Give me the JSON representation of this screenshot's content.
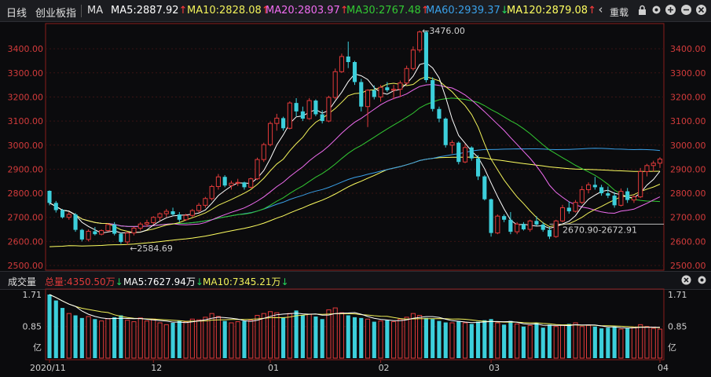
{
  "header": {
    "tab_day": "日线",
    "index_name": "创业板指",
    "indicator": "MA",
    "back_icon": "‹",
    "reset_label": "重载",
    "ma": [
      {
        "label": "MA5:2887.92",
        "arrow": "↑",
        "color": "#ffffff",
        "arrow_color": "#ff3b3b"
      },
      {
        "label": "MA10:2828.08",
        "arrow": "↑",
        "color": "#f2f25a",
        "arrow_color": "#ff3b3b"
      },
      {
        "label": "MA20:2803.97",
        "arrow": "↑",
        "color": "#f06cf0",
        "arrow_color": "#ff3b3b"
      },
      {
        "label": "MA30:2767.48",
        "arrow": "↑",
        "color": "#32c832",
        "arrow_color": "#ff3b3b"
      },
      {
        "label": "MA60:2939.37",
        "arrow": "↓",
        "color": "#3aa0e8",
        "arrow_color": "#22d45a"
      },
      {
        "label": "MA120:2879.08",
        "arrow": "↑",
        "color": "#ffff60",
        "arrow_color": "#ff3b3b"
      }
    ]
  },
  "volume_header": {
    "title": "成交量",
    "total": "总量:4350.50万",
    "total_arrow": "↓",
    "ma5": "MA5:7627.94万",
    "ma5_arrow": "↓",
    "ma10": "MA10:7345.21万",
    "ma10_arrow": "↓"
  },
  "colors": {
    "up": "#e23a3a",
    "down": "#3ccfdb",
    "ma5": "#ffffff",
    "ma10": "#f2f25a",
    "ma20": "#f06cf0",
    "ma30": "#32c832",
    "ma60": "#3aa0e8",
    "ma120": "#ffff60"
  },
  "chart_data": {
    "type": "candlestick",
    "price_axis": {
      "ylim": [
        2500,
        3500
      ],
      "ticks": [
        "3400.00",
        "3300.00",
        "3200.00",
        "3100.00",
        "3000.00",
        "2900.00",
        "2800.00",
        "2700.00",
        "2600.00",
        "2500.00"
      ]
    },
    "volume_axis": {
      "ticks": [
        "1.71",
        "0.85",
        "亿"
      ]
    },
    "x_labels": [
      "2020/11",
      "12",
      "01",
      "02",
      "03",
      "04"
    ],
    "annotations": {
      "high": "3476.00",
      "low": "2584.69",
      "support": "2670.90-2672.91",
      "high_value": 3476.0,
      "low_value": 2584.69,
      "support_value": 2671.9
    },
    "ohlc": [
      [
        2810,
        2812,
        2750,
        2760
      ],
      [
        2760,
        2768,
        2720,
        2730
      ],
      [
        2730,
        2735,
        2695,
        2700
      ],
      [
        2700,
        2722,
        2690,
        2712
      ],
      [
        2712,
        2718,
        2640,
        2648
      ],
      [
        2648,
        2652,
        2600,
        2608
      ],
      [
        2608,
        2650,
        2600,
        2642
      ],
      [
        2642,
        2660,
        2625,
        2630
      ],
      [
        2630,
        2650,
        2625,
        2645
      ],
      [
        2645,
        2675,
        2640,
        2670
      ],
      [
        2670,
        2680,
        2625,
        2632
      ],
      [
        2632,
        2636,
        2590,
        2598
      ],
      [
        2598,
        2640,
        2584.69,
        2635
      ],
      [
        2635,
        2660,
        2625,
        2655
      ],
      [
        2655,
        2680,
        2645,
        2672
      ],
      [
        2672,
        2690,
        2660,
        2678
      ],
      [
        2678,
        2705,
        2670,
        2700
      ],
      [
        2700,
        2720,
        2685,
        2715
      ],
      [
        2715,
        2735,
        2700,
        2725
      ],
      [
        2725,
        2740,
        2705,
        2712
      ],
      [
        2712,
        2722,
        2680,
        2690
      ],
      [
        2690,
        2715,
        2685,
        2708
      ],
      [
        2708,
        2735,
        2700,
        2728
      ],
      [
        2728,
        2760,
        2720,
        2750
      ],
      [
        2750,
        2785,
        2740,
        2778
      ],
      [
        2778,
        2835,
        2770,
        2828
      ],
      [
        2828,
        2880,
        2815,
        2868
      ],
      [
        2868,
        2875,
        2825,
        2832
      ],
      [
        2832,
        2852,
        2815,
        2842
      ],
      [
        2842,
        2860,
        2830,
        2845
      ],
      [
        2845,
        2848,
        2815,
        2825
      ],
      [
        2825,
        2865,
        2820,
        2860
      ],
      [
        2860,
        2948,
        2855,
        2940
      ],
      [
        2940,
        3010,
        2930,
        3002
      ],
      [
        3002,
        3098,
        2995,
        3090
      ],
      [
        3090,
        3130,
        3060,
        3112
      ],
      [
        3112,
        3118,
        3060,
        3070
      ],
      [
        3070,
        3182,
        3065,
        3175
      ],
      [
        3175,
        3195,
        3120,
        3140
      ],
      [
        3140,
        3160,
        3100,
        3110
      ],
      [
        3110,
        3195,
        3105,
        3185
      ],
      [
        3185,
        3190,
        3120,
        3128
      ],
      [
        3128,
        3145,
        3090,
        3100
      ],
      [
        3100,
        3205,
        3095,
        3198
      ],
      [
        3198,
        3318,
        3190,
        3305
      ],
      [
        3305,
        3380,
        3300,
        3368
      ],
      [
        3368,
        3430,
        3320,
        3345
      ],
      [
        3345,
        3350,
        3250,
        3262
      ],
      [
        3262,
        3275,
        3140,
        3160
      ],
      [
        3160,
        3232,
        3075,
        3228
      ],
      [
        3228,
        3248,
        3190,
        3200
      ],
      [
        3200,
        3250,
        3180,
        3240
      ],
      [
        3240,
        3262,
        3220,
        3228
      ],
      [
        3228,
        3250,
        3190,
        3232
      ],
      [
        3232,
        3268,
        3200,
        3258
      ],
      [
        3258,
        3330,
        3250,
        3318
      ],
      [
        3318,
        3410,
        3310,
        3395
      ],
      [
        3395,
        3476,
        3385,
        3470
      ],
      [
        3470,
        3476,
        3260,
        3270
      ],
      [
        3270,
        3282,
        3140,
        3150
      ],
      [
        3150,
        3160,
        3095,
        3110
      ],
      [
        3110,
        3115,
        2990,
        3000
      ],
      [
        3000,
        3020,
        2965,
        3010
      ],
      [
        3010,
        3015,
        2920,
        2930
      ],
      [
        2930,
        3005,
        2925,
        2990
      ],
      [
        2990,
        2995,
        2935,
        2945
      ],
      [
        2945,
        2958,
        2855,
        2870
      ],
      [
        2870,
        2875,
        2770,
        2775
      ],
      [
        2775,
        2778,
        2620,
        2635
      ],
      [
        2635,
        2712,
        2630,
        2705
      ],
      [
        2705,
        2712,
        2680,
        2690
      ],
      [
        2690,
        2722,
        2630,
        2640
      ],
      [
        2640,
        2680,
        2630,
        2672
      ],
      [
        2672,
        2680,
        2645,
        2650
      ],
      [
        2650,
        2690,
        2640,
        2685
      ],
      [
        2685,
        2705,
        2665,
        2670
      ],
      [
        2670,
        2680,
        2640,
        2648
      ],
      [
        2648,
        2660,
        2610,
        2620
      ],
      [
        2620,
        2690,
        2615,
        2685
      ],
      [
        2685,
        2752,
        2680,
        2740
      ],
      [
        2740,
        2766,
        2715,
        2725
      ],
      [
        2725,
        2772,
        2720,
        2762
      ],
      [
        2762,
        2830,
        2755,
        2815
      ],
      [
        2815,
        2845,
        2800,
        2835
      ],
      [
        2835,
        2868,
        2815,
        2825
      ],
      [
        2825,
        2835,
        2790,
        2800
      ],
      [
        2800,
        2828,
        2780,
        2790
      ],
      [
        2790,
        2805,
        2740,
        2750
      ],
      [
        2750,
        2820,
        2745,
        2808
      ],
      [
        2808,
        2822,
        2760,
        2772
      ],
      [
        2772,
        2792,
        2760,
        2785
      ],
      [
        2785,
        2905,
        2780,
        2890
      ],
      [
        2890,
        2922,
        2870,
        2915
      ],
      [
        2915,
        2935,
        2890,
        2925
      ],
      [
        2925,
        2950,
        2905,
        2942
      ]
    ],
    "volume": [
      1.71,
      1.55,
      1.35,
      1.2,
      1.15,
      1.08,
      1.12,
      1.05,
      1.0,
      1.06,
      1.1,
      1.15,
      1.02,
      0.98,
      1.08,
      1.0,
      1.05,
      0.95,
      0.9,
      0.95,
      1.0,
      0.98,
      1.05,
      1.03,
      1.1,
      1.2,
      1.12,
      1.0,
      0.95,
      0.98,
      1.0,
      1.02,
      1.15,
      1.2,
      1.25,
      1.22,
      1.1,
      1.2,
      1.28,
      1.15,
      1.18,
      1.12,
      1.05,
      1.3,
      1.35,
      1.22,
      1.15,
      1.1,
      1.08,
      1.05,
      0.98,
      1.0,
      1.02,
      0.98,
      1.05,
      1.1,
      1.2,
      1.15,
      1.08,
      1.05,
      1.0,
      0.96,
      0.95,
      1.0,
      0.95,
      0.92,
      0.98,
      1.02,
      1.05,
      0.95,
      0.9,
      1.0,
      0.92,
      0.85,
      0.88,
      0.95,
      0.82,
      0.9,
      0.85,
      0.88,
      0.92,
      0.95,
      0.85,
      0.88,
      0.85,
      0.8,
      0.82,
      0.85,
      0.78,
      0.8,
      0.82,
      0.9,
      0.85,
      0.8,
      0.78
    ]
  }
}
